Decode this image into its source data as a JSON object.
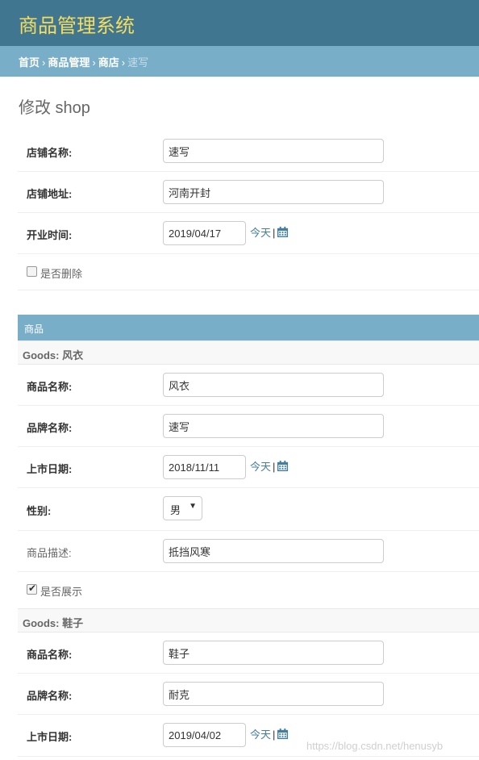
{
  "header": {
    "brand": "商品管理系统"
  },
  "breadcrumbs": {
    "home": "首页",
    "app": "商品管理",
    "model": "商店",
    "current": "速写",
    "sep": "›"
  },
  "page_title": "修改 shop",
  "shop": {
    "name_label": "店铺名称:",
    "name_value": "速写",
    "address_label": "店铺地址:",
    "address_value": "河南开封",
    "open_label": "开业时间:",
    "open_value": "2019/04/17",
    "deleted_label": "是否删除",
    "deleted_checked": false
  },
  "today_link": "今天",
  "today_sep": "|",
  "inline": {
    "caption": "商品",
    "items": [
      {
        "heading": "Goods: 风衣",
        "name_label": "商品名称:",
        "name_value": "风衣",
        "brand_label": "品牌名称:",
        "brand_value": "速写",
        "date_label": "上市日期:",
        "date_value": "2018/11/11",
        "gender_label": "性别:",
        "gender_value": "男",
        "desc_label": "商品描述:",
        "desc_value": "抵挡风寒",
        "show_label": "是否展示",
        "show_checked": true
      },
      {
        "heading": "Goods: 鞋子",
        "name_label": "商品名称:",
        "name_value": "鞋子",
        "brand_label": "品牌名称:",
        "brand_value": "耐克",
        "date_label": "上市日期:",
        "date_value": "2019/04/02"
      }
    ]
  },
  "watermark": "https://blog.csdn.net/henusyb",
  "colors": {
    "header": "#417690",
    "breadcrumbs": "#79aec8",
    "brand": "#f5dd5d",
    "link": "#447e9b"
  }
}
